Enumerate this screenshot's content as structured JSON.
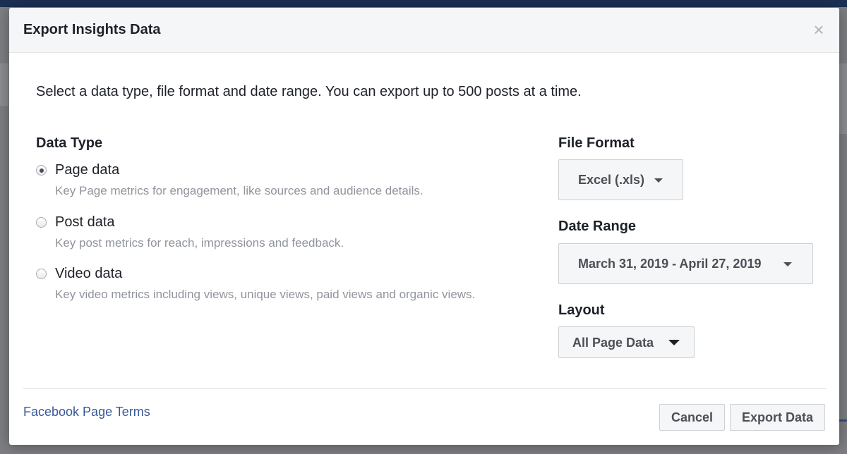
{
  "dialog": {
    "title": "Export Insights Data",
    "close_icon": "close-icon"
  },
  "intro_text": "Select a data type, file format and date range. You can export up to 500 posts at a time.",
  "data_type": {
    "label": "Data Type",
    "selected": "Page data",
    "options": [
      {
        "label": "Page data",
        "description": "Key Page metrics for engagement, like sources and audience details."
      },
      {
        "label": "Post data",
        "description": "Key post metrics for reach, impressions and feedback."
      },
      {
        "label": "Video data",
        "description": "Key video metrics including views, unique views, paid views and organic views."
      }
    ]
  },
  "file_format": {
    "label": "File Format",
    "value": "Excel (.xls)"
  },
  "date_range": {
    "label": "Date Range",
    "value": "March 31, 2019 - April 27, 2019"
  },
  "layout": {
    "label": "Layout",
    "value": "All Page Data"
  },
  "footer": {
    "terms_link": "Facebook Page Terms",
    "cancel_label": "Cancel",
    "export_label": "Export Data"
  },
  "colors": {
    "link": "#385898",
    "text": "#1d2129",
    "muted": "#90949c"
  }
}
